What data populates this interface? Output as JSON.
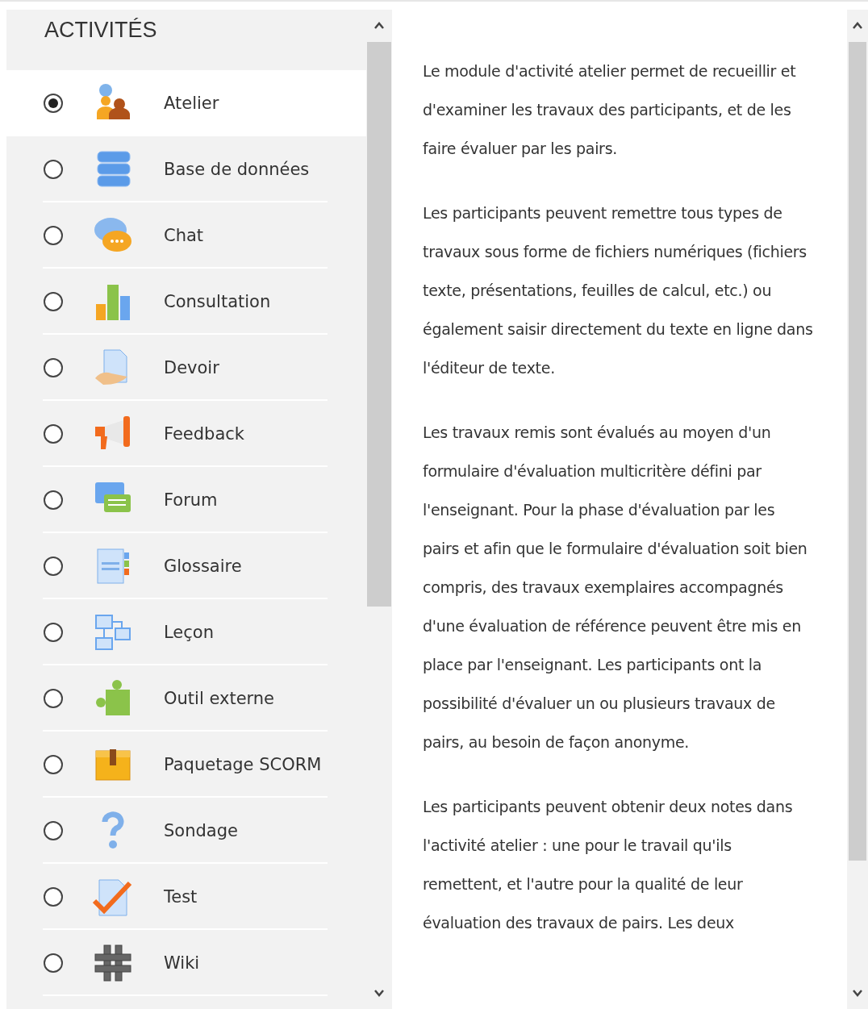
{
  "panel_title": "ACTIVITÉS",
  "activities": [
    {
      "label": "Atelier",
      "kind": "workshop",
      "selected": true
    },
    {
      "label": "Base de données",
      "kind": "database",
      "selected": false
    },
    {
      "label": "Chat",
      "kind": "chat",
      "selected": false
    },
    {
      "label": "Consultation",
      "kind": "poll",
      "selected": false
    },
    {
      "label": "Devoir",
      "kind": "assignment",
      "selected": false
    },
    {
      "label": "Feedback",
      "kind": "feedback",
      "selected": false
    },
    {
      "label": "Forum",
      "kind": "forum",
      "selected": false
    },
    {
      "label": "Glossaire",
      "kind": "glossary",
      "selected": false
    },
    {
      "label": "Leçon",
      "kind": "lesson",
      "selected": false
    },
    {
      "label": "Outil externe",
      "kind": "external",
      "selected": false
    },
    {
      "label": "Paquetage SCORM",
      "kind": "package",
      "selected": false
    },
    {
      "label": "Sondage",
      "kind": "survey",
      "selected": false
    },
    {
      "label": "Test",
      "kind": "quiz",
      "selected": false
    },
    {
      "label": "Wiki",
      "kind": "wiki",
      "selected": false
    }
  ],
  "description": [
    "Le module d'activité atelier permet de recueillir et d'examiner les travaux des participants, et de les faire évaluer par les pairs.",
    "Les participants peuvent remettre tous types de travaux sous forme de fichiers numériques (fichiers texte, présentations, feuilles de calcul, etc.) ou également saisir directement du texte en ligne dans l'éditeur de texte.",
    "Les travaux remis sont évalués au moyen d'un formulaire d'évaluation multicritère défini par l'enseignant. Pour la phase d'évaluation par les pairs et afin que le formulaire d'évaluation soit bien compris, des travaux exemplaires accompagnés d'une évaluation de référence peuvent être mis en place par l'enseignant. Les participants ont la possibilité d'évaluer un ou plusieurs travaux de pairs, au besoin de façon anonyme.",
    "Les participants peuvent obtenir deux notes dans l'activité atelier : une pour le travail qu'ils remettent, et l'autre pour la qualité de leur évaluation des travaux de pairs. Les deux"
  ]
}
